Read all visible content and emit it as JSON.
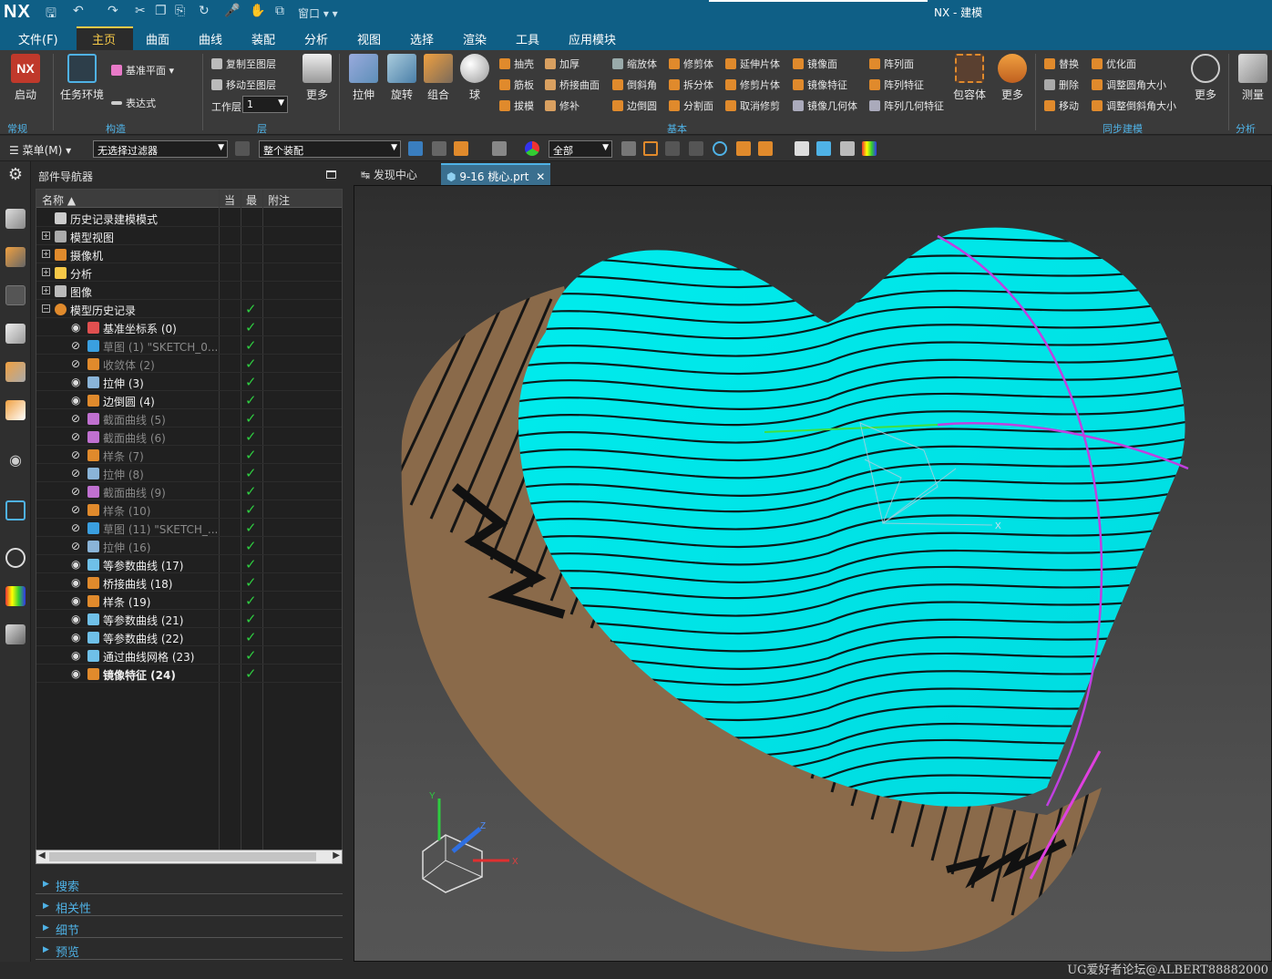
{
  "app": {
    "logo": "NX",
    "title": "NX - 建模",
    "window_menu": "窗口"
  },
  "menu": {
    "items": [
      "文件(F)",
      "主页",
      "曲面",
      "曲线",
      "装配",
      "分析",
      "视图",
      "选择",
      "渲染",
      "工具",
      "应用模块"
    ],
    "active": "主页"
  },
  "ribbon": {
    "start": "启动",
    "task_env": "任务环境",
    "datum_plane": "基准平面",
    "expression": "表达式",
    "copy_to_layer": "复制至图层",
    "move_to_layer": "移动至图层",
    "work_layer_label": "工作层",
    "work_layer_value": "1",
    "more1": "更多",
    "extrude": "拉伸",
    "revolve": "旋转",
    "combine": "组合",
    "sphere": "球",
    "shell": "抽壳",
    "thicken": "加厚",
    "rib": "筋板",
    "bridge_surface": "桥接曲面",
    "draft": "拔模",
    "patch": "修补",
    "scale_body": "缩放体",
    "trim_body": "修剪体",
    "extend_sheet": "延伸片体",
    "mirror_face": "镜像面",
    "pattern_face": "阵列面",
    "chamfer": "倒斜角",
    "split_body": "拆分体",
    "trim_sheet": "修剪片体",
    "mirror_feature": "镜像特征",
    "pattern_feature": "阵列特征",
    "edge_blend": "边倒圆",
    "divide_face": "分割面",
    "unblend": "取消修剪",
    "mirror_geometry": "镜像几何体",
    "pattern_geometry": "阵列几何特征",
    "bounding_body": "包容体",
    "more2": "更多",
    "replace": "替换",
    "optimize": "优化面",
    "delete": "删除",
    "resize_blend": "调整圆角大小",
    "move": "移动",
    "resize_chamfer": "调整倒斜角大小",
    "more3": "更多",
    "measure": "测量",
    "groups": {
      "general": "常规",
      "construct": "构造",
      "layer": "层",
      "basic": "基本",
      "sync": "同步建模",
      "analysis": "分析"
    }
  },
  "toolbar2": {
    "menu_label": "菜单(M)",
    "filter": "无选择过滤器",
    "scope": "整个装配",
    "all": "全部"
  },
  "navigator": {
    "title": "部件导航器",
    "columns": [
      "名称",
      "当",
      "最",
      "附注"
    ],
    "rows": [
      {
        "label": "历史记录建模模式",
        "indent": 0,
        "icon": "clock-icon",
        "dim": false,
        "check": false
      },
      {
        "label": "模型视图",
        "indent": 0,
        "icon": "view-icon",
        "dim": false,
        "check": false,
        "expand": "+"
      },
      {
        "label": "摄像机",
        "indent": 0,
        "icon": "camera-icon",
        "dim": false,
        "check": false,
        "expand": "+"
      },
      {
        "label": "分析",
        "indent": 0,
        "icon": "analysis-icon",
        "dim": false,
        "check": false,
        "expand": "+"
      },
      {
        "label": "图像",
        "indent": 0,
        "icon": "folder-icon",
        "dim": false,
        "check": false,
        "expand": "+"
      },
      {
        "label": "模型历史记录",
        "indent": 0,
        "icon": "history-icon",
        "dim": false,
        "check": true,
        "expand": "-"
      },
      {
        "label": "基准坐标系 (0)",
        "indent": 1,
        "icon": "csys-icon",
        "dim": false,
        "check": true
      },
      {
        "label": "草图 (1) \"SKETCH_0...",
        "indent": 1,
        "icon": "sketch-icon",
        "dim": true,
        "check": true
      },
      {
        "label": "收敛体 (2)",
        "indent": 1,
        "icon": "convergent-icon",
        "dim": true,
        "check": true
      },
      {
        "label": "拉伸 (3)",
        "indent": 1,
        "icon": "extrude-icon",
        "dim": false,
        "check": true
      },
      {
        "label": "边倒圆 (4)",
        "indent": 1,
        "icon": "blend-icon",
        "dim": false,
        "check": true
      },
      {
        "label": "截面曲线 (5)",
        "indent": 1,
        "icon": "section-curve-icon",
        "dim": true,
        "check": true
      },
      {
        "label": "截面曲线 (6)",
        "indent": 1,
        "icon": "section-curve-icon",
        "dim": true,
        "check": true
      },
      {
        "label": "样条 (7)",
        "indent": 1,
        "icon": "spline-icon",
        "dim": true,
        "check": true
      },
      {
        "label": "拉伸 (8)",
        "indent": 1,
        "icon": "extrude-icon",
        "dim": true,
        "check": true
      },
      {
        "label": "截面曲线 (9)",
        "indent": 1,
        "icon": "section-curve-icon",
        "dim": true,
        "check": true
      },
      {
        "label": "样条 (10)",
        "indent": 1,
        "icon": "spline-icon",
        "dim": true,
        "check": true
      },
      {
        "label": "草图 (11) \"SKETCH_...",
        "indent": 1,
        "icon": "sketch-icon",
        "dim": true,
        "check": true
      },
      {
        "label": "拉伸 (16)",
        "indent": 1,
        "icon": "extrude-icon",
        "dim": true,
        "check": true
      },
      {
        "label": "等参数曲线 (17)",
        "indent": 1,
        "icon": "isoparam-icon",
        "dim": false,
        "check": true
      },
      {
        "label": "桥接曲线 (18)",
        "indent": 1,
        "icon": "bridge-curve-icon",
        "dim": false,
        "check": true
      },
      {
        "label": "样条 (19)",
        "indent": 1,
        "icon": "spline-icon",
        "dim": false,
        "check": true
      },
      {
        "label": "等参数曲线 (21)",
        "indent": 1,
        "icon": "isoparam-icon",
        "dim": false,
        "check": true
      },
      {
        "label": "等参数曲线 (22)",
        "indent": 1,
        "icon": "isoparam-icon",
        "dim": false,
        "check": true
      },
      {
        "label": "通过曲线网格 (23)",
        "indent": 1,
        "icon": "mesh-surface-icon",
        "dim": false,
        "check": true
      },
      {
        "label": "镜像特征 (24)",
        "indent": 1,
        "icon": "mirror-feature-icon",
        "dim": false,
        "check": true,
        "bold": true
      }
    ],
    "panels": [
      "搜索",
      "相关性",
      "细节",
      "预览"
    ]
  },
  "tabs": [
    {
      "label": "发现中心",
      "active": false
    },
    {
      "label": "9-16 桃心.prt",
      "active": true
    }
  ],
  "viewport": {
    "axis_x": "X",
    "axis_y": "Y",
    "axis_z": "Z"
  },
  "watermark": "UG爱好者论坛@ALBERT88882000",
  "colors": {
    "accent": "#0f5f86",
    "highlight": "#4fb2e6",
    "surface": "#00e5e5",
    "base": "#8a6a4a",
    "check": "#2ecc40"
  }
}
